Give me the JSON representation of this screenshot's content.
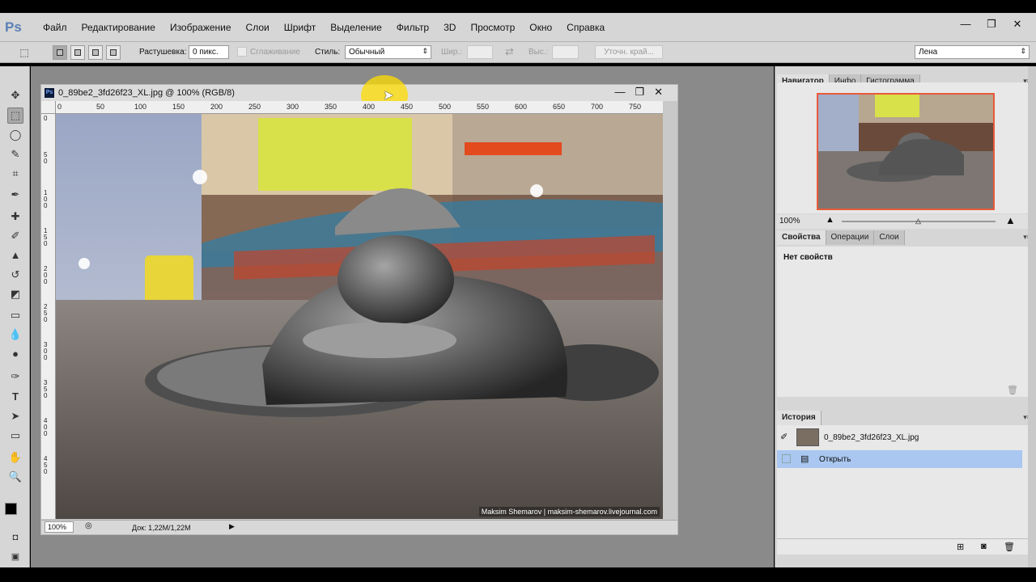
{
  "app": {
    "logo": "Ps"
  },
  "menu": [
    "Файл",
    "Редактирование",
    "Изображение",
    "Слои",
    "Шрифт",
    "Выделение",
    "Фильтр",
    "3D",
    "Просмотр",
    "Окно",
    "Справка"
  ],
  "options": {
    "feather_label": "Растушевка:",
    "feather_value": "0 пикс.",
    "antialias_label": "Сглаживание",
    "style_label": "Стиль:",
    "style_value": "Обычный",
    "width_label": "Шир.:",
    "height_label": "Выс.:",
    "refine_label": "Уточн. край...",
    "workspace_value": "Лена"
  },
  "document": {
    "title": "0_89be2_3fd26f23_XL.jpg @ 100% (RGB/8)",
    "ruler_h": [
      "0",
      "50",
      "100",
      "150",
      "200",
      "250",
      "300",
      "350",
      "400",
      "450",
      "500",
      "550",
      "600",
      "650",
      "700",
      "750"
    ],
    "ruler_v": [
      "0",
      "5 0",
      "1 0 0",
      "1 5 0",
      "2 0 0",
      "2 5 0",
      "3 0 0",
      "3 5 0",
      "4 0 0",
      "4 5 0"
    ],
    "credit": "Maksim Shemarov | maksim-shemarov.livejournal.com",
    "zoom": "100%",
    "doc_size": "Док: 1,22M/1,22M"
  },
  "navigator_panel": {
    "tabs": [
      "Навигатор",
      "Инфо",
      "Гистограмма"
    ],
    "zoom": "100%"
  },
  "properties_panel": {
    "tabs": [
      "Свойства",
      "Операции",
      "Слои"
    ],
    "empty_text": "Нет свойств"
  },
  "history_panel": {
    "tabs": [
      "История"
    ],
    "snapshot": "0_89be2_3fd26f23_XL.jpg",
    "items": [
      "Открыть"
    ]
  },
  "colors": {
    "accent_selection": "#a9c7f0",
    "workspace_bg": "#8a8a8a",
    "nav_frame": "#e85a3a"
  }
}
